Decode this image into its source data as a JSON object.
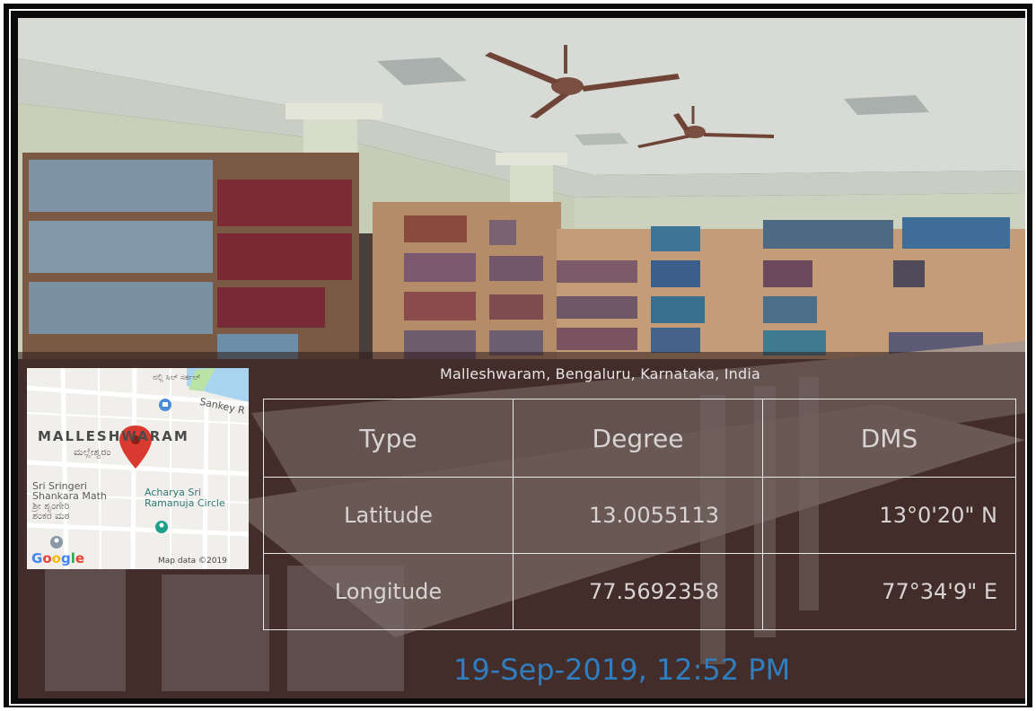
{
  "location": {
    "address": "Malleshwaram, Bengaluru, Karnataka, India"
  },
  "table": {
    "headers": {
      "type": "Type",
      "degree": "Degree",
      "dms": "DMS"
    },
    "rows": [
      {
        "type": "Latitude",
        "degree": "13.0055113",
        "dms": "13°0'20\" N"
      },
      {
        "type": "Longitude",
        "degree": "77.5692358",
        "dms": "77°34'9\" E"
      }
    ]
  },
  "timestamp": "19-Sep-2019, 12:52 PM",
  "map": {
    "area_label": "MALLESHWARAM",
    "area_label_local": "ಮಲ್ಲೇಶ್ವರಂ",
    "road_label": "Sankey R",
    "poi_local": "ನಲ್ಲಿ ಸಿಲ್ ಸರ್ಕಲ್",
    "poi_sringeri": [
      "Sri Sringeri",
      "Shankara Math",
      "ಶ್ರೀ ಶೃಂಗೇರಿ",
      "ಶಂಕರ ಮಠ"
    ],
    "poi_acharya": [
      "Acharya Sri",
      "Ramanuja Circle"
    ],
    "map_data": "Map data ©2019",
    "logo": "Google"
  },
  "colors": {
    "timestamp": "#2f7ec0",
    "pin": "#d93a2f",
    "table_border": "#e9e9e9"
  },
  "icons": [
    "map-pin-icon",
    "poi-marker-icon",
    "park-marker-icon"
  ]
}
